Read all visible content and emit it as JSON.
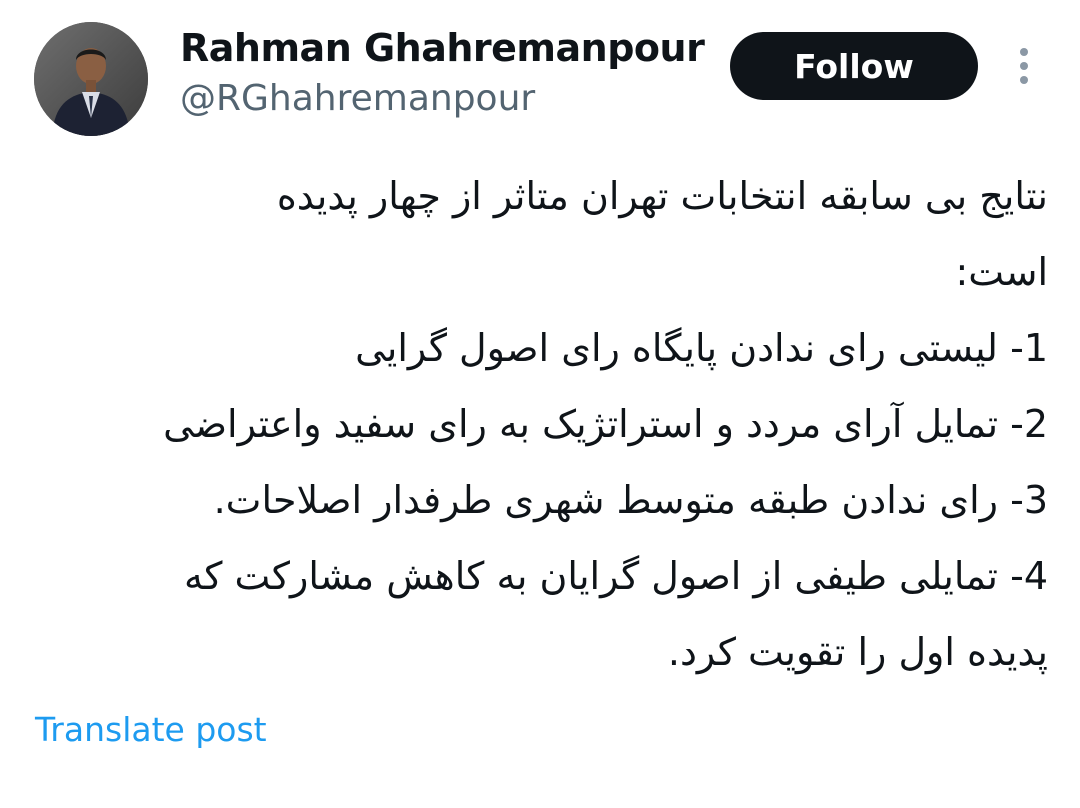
{
  "author": {
    "name": "Rahman Ghahremanpour",
    "handle": "@RGhahremanpour",
    "avatar_icon": "person-photo-avatar"
  },
  "actions": {
    "follow_label": "Follow",
    "more_icon": "vertical-ellipsis-icon",
    "translate_label": "Translate post"
  },
  "tweet": {
    "lines": [
      "نتایج  بی سابقه انتخابات تهران متاثر از چهار پدیده",
      "است:",
      "1- لیستی رای ندادن پایگاه رای اصول گرایی",
      "2- تمایل آرای مردد و استراتژیک به رای سفید واعتراضی",
      "3- رای ندادن طبقه متوسط شهری طرفدار اصلاحات.",
      "4- تمایلی طیفی از اصول گرایان به کاهش مشارکت که",
      "پدیده اول را تقویت کرد."
    ]
  },
  "colors": {
    "text_primary": "#0f1419",
    "text_secondary": "#536471",
    "link": "#1d9bf0",
    "button_bg": "#0f1419",
    "button_text": "#ffffff"
  }
}
